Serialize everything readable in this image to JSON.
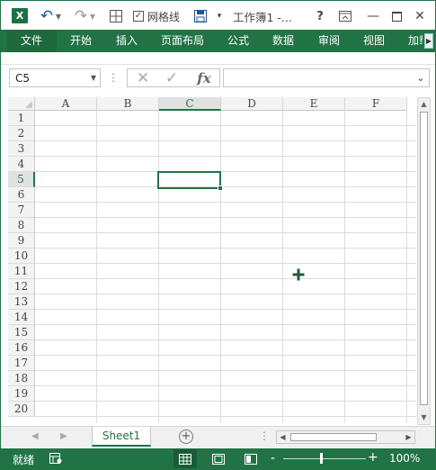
{
  "title_bar": {
    "app_icon_letter": "X",
    "gridlines_checked": true,
    "gridlines_label": "网格线",
    "document_title": "工作簿1 -...",
    "help_label": "?",
    "icons": [
      "excel-logo-icon",
      "undo-icon",
      "redo-icon",
      "borders-icon",
      "save-icon",
      "customize-qat-icon",
      "ribbon-display-icon",
      "minimize-icon",
      "maximize-icon",
      "close-icon"
    ]
  },
  "ribbon": {
    "tabs": [
      "文件",
      "开始",
      "插入",
      "页面布局",
      "公式",
      "数据",
      "审阅",
      "视图",
      "加载"
    ],
    "accent_color": "#217346"
  },
  "formula_bar": {
    "name_box": "C5",
    "formula_value": "",
    "fx_label": "fx"
  },
  "grid": {
    "columns": [
      "A",
      "B",
      "C",
      "D",
      "E",
      "F"
    ],
    "rows": [
      "1",
      "2",
      "3",
      "4",
      "5",
      "6",
      "7",
      "8",
      "9",
      "10",
      "11",
      "12",
      "13",
      "14",
      "15",
      "16",
      "17",
      "18",
      "19",
      "20"
    ],
    "selected_column": "C",
    "selected_row": "5",
    "active_cell": "C5"
  },
  "sheet_tabs": {
    "tabs": [
      "Sheet1"
    ],
    "active": "Sheet1",
    "add_label": "+"
  },
  "status_bar": {
    "status": "就绪",
    "zoom": "100%",
    "zoom_minus": "-",
    "zoom_plus": "+",
    "active_view": "normal"
  }
}
